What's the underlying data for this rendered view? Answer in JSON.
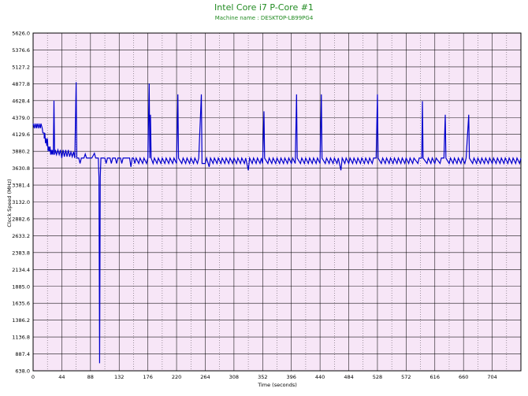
{
  "chart_data": {
    "type": "line",
    "title": "Intel Core i7 P-Core #1",
    "subtitle": "Machine name : DESKTOP-LB99PG4",
    "xlabel": "Time (seconds)",
    "ylabel": "Clock Speed (MHz)",
    "xlim": [
      0,
      748
    ],
    "ylim": [
      638.0,
      5626.0
    ],
    "x_ticks": [
      "0",
      "44",
      "88",
      "132",
      "176",
      "220",
      "264",
      "308",
      "352",
      "396",
      "440",
      "484",
      "528",
      "572",
      "616",
      "660",
      "704"
    ],
    "y_ticks": [
      "638.0",
      "887.4",
      "1136.8",
      "1386.2",
      "1635.6",
      "1885.0",
      "2134.4",
      "2383.8",
      "2633.2",
      "2882.6",
      "3132.0",
      "3381.4",
      "3630.8",
      "3880.2",
      "4129.6",
      "4379.0",
      "4628.4",
      "4877.8",
      "5127.2",
      "5376.6",
      "5626.0"
    ],
    "grid": true,
    "legend": "none",
    "series": [
      {
        "values": [
          [
            0,
            4290
          ],
          [
            2,
            4220
          ],
          [
            3,
            4290
          ],
          [
            5,
            4220
          ],
          [
            6,
            4290
          ],
          [
            8,
            4220
          ],
          [
            9,
            4290
          ],
          [
            11,
            4220
          ],
          [
            12,
            4290
          ],
          [
            14,
            4220
          ],
          [
            15,
            4150
          ],
          [
            17,
            4150
          ],
          [
            17,
            4070
          ],
          [
            18,
            4150
          ],
          [
            19,
            4000
          ],
          [
            20,
            4070
          ],
          [
            21,
            3960
          ],
          [
            22,
            4070
          ],
          [
            23,
            3880
          ],
          [
            24,
            3950
          ],
          [
            25,
            3880
          ],
          [
            26,
            3950
          ],
          [
            27,
            3830
          ],
          [
            28,
            3900
          ],
          [
            29,
            3830
          ],
          [
            30,
            3900
          ],
          [
            31,
            3830
          ],
          [
            32,
            4630
          ],
          [
            33,
            3830
          ],
          [
            34,
            3900
          ],
          [
            36,
            3830
          ],
          [
            38,
            3900
          ],
          [
            40,
            3830
          ],
          [
            42,
            3900
          ],
          [
            44,
            3780
          ],
          [
            46,
            3900
          ],
          [
            48,
            3800
          ],
          [
            50,
            3900
          ],
          [
            52,
            3800
          ],
          [
            54,
            3900
          ],
          [
            56,
            3800
          ],
          [
            58,
            3870
          ],
          [
            60,
            3800
          ],
          [
            62,
            3870
          ],
          [
            64,
            3780
          ],
          [
            66,
            4900
          ],
          [
            67,
            3780
          ],
          [
            70,
            3780
          ],
          [
            72,
            3700
          ],
          [
            74,
            3780
          ],
          [
            78,
            3780
          ],
          [
            80,
            3840
          ],
          [
            82,
            3780
          ],
          [
            90,
            3780
          ],
          [
            94,
            3850
          ],
          [
            96,
            3780
          ],
          [
            100,
            3780
          ],
          [
            101,
            3500
          ],
          [
            102,
            750
          ],
          [
            103,
            3500
          ],
          [
            104,
            3780
          ],
          [
            110,
            3780
          ],
          [
            112,
            3700
          ],
          [
            114,
            3780
          ],
          [
            118,
            3780
          ],
          [
            120,
            3700
          ],
          [
            122,
            3780
          ],
          [
            126,
            3780
          ],
          [
            128,
            3700
          ],
          [
            130,
            3780
          ],
          [
            134,
            3780
          ],
          [
            136,
            3700
          ],
          [
            138,
            3780
          ],
          [
            148,
            3780
          ],
          [
            150,
            3650
          ],
          [
            152,
            3780
          ],
          [
            154,
            3780
          ],
          [
            156,
            3700
          ],
          [
            158,
            3780
          ],
          [
            162,
            3700
          ],
          [
            164,
            3780
          ],
          [
            168,
            3700
          ],
          [
            170,
            3780
          ],
          [
            174,
            3700
          ],
          [
            176,
            3780
          ],
          [
            178,
            4880
          ],
          [
            179,
            3780
          ],
          [
            180,
            4420
          ],
          [
            181,
            3780
          ],
          [
            184,
            3700
          ],
          [
            186,
            3780
          ],
          [
            190,
            3700
          ],
          [
            192,
            3780
          ],
          [
            196,
            3700
          ],
          [
            198,
            3780
          ],
          [
            202,
            3700
          ],
          [
            204,
            3780
          ],
          [
            208,
            3700
          ],
          [
            210,
            3780
          ],
          [
            214,
            3700
          ],
          [
            216,
            3780
          ],
          [
            220,
            3700
          ],
          [
            222,
            4720
          ],
          [
            223,
            3780
          ],
          [
            228,
            3700
          ],
          [
            230,
            3780
          ],
          [
            234,
            3700
          ],
          [
            236,
            3780
          ],
          [
            240,
            3700
          ],
          [
            242,
            3780
          ],
          [
            246,
            3700
          ],
          [
            248,
            3780
          ],
          [
            252,
            3700
          ],
          [
            254,
            3780
          ],
          [
            258,
            4720
          ],
          [
            259,
            3700
          ],
          [
            264,
            3700
          ],
          [
            266,
            3780
          ],
          [
            270,
            3650
          ],
          [
            272,
            3780
          ],
          [
            276,
            3700
          ],
          [
            278,
            3780
          ],
          [
            282,
            3700
          ],
          [
            284,
            3780
          ],
          [
            288,
            3700
          ],
          [
            290,
            3780
          ],
          [
            294,
            3700
          ],
          [
            296,
            3780
          ],
          [
            300,
            3700
          ],
          [
            302,
            3780
          ],
          [
            306,
            3700
          ],
          [
            308,
            3780
          ],
          [
            312,
            3700
          ],
          [
            314,
            3780
          ],
          [
            318,
            3700
          ],
          [
            320,
            3780
          ],
          [
            324,
            3700
          ],
          [
            326,
            3780
          ],
          [
            330,
            3600
          ],
          [
            332,
            3780
          ],
          [
            336,
            3700
          ],
          [
            338,
            3780
          ],
          [
            342,
            3700
          ],
          [
            344,
            3780
          ],
          [
            348,
            3700
          ],
          [
            350,
            3780
          ],
          [
            352,
            3700
          ],
          [
            354,
            4470
          ],
          [
            355,
            3780
          ],
          [
            360,
            3700
          ],
          [
            362,
            3780
          ],
          [
            366,
            3700
          ],
          [
            368,
            3780
          ],
          [
            372,
            3700
          ],
          [
            374,
            3780
          ],
          [
            378,
            3700
          ],
          [
            380,
            3780
          ],
          [
            384,
            3700
          ],
          [
            386,
            3780
          ],
          [
            390,
            3700
          ],
          [
            392,
            3780
          ],
          [
            396,
            3700
          ],
          [
            398,
            3780
          ],
          [
            402,
            3700
          ],
          [
            404,
            4720
          ],
          [
            405,
            3780
          ],
          [
            410,
            3700
          ],
          [
            412,
            3780
          ],
          [
            416,
            3700
          ],
          [
            418,
            3780
          ],
          [
            422,
            3700
          ],
          [
            424,
            3780
          ],
          [
            428,
            3700
          ],
          [
            430,
            3780
          ],
          [
            434,
            3700
          ],
          [
            436,
            3780
          ],
          [
            440,
            3700
          ],
          [
            442,
            4720
          ],
          [
            443,
            3780
          ],
          [
            448,
            3700
          ],
          [
            450,
            3780
          ],
          [
            454,
            3700
          ],
          [
            456,
            3780
          ],
          [
            460,
            3700
          ],
          [
            462,
            3780
          ],
          [
            466,
            3700
          ],
          [
            468,
            3780
          ],
          [
            472,
            3600
          ],
          [
            474,
            3780
          ],
          [
            478,
            3700
          ],
          [
            480,
            3780
          ],
          [
            484,
            3700
          ],
          [
            486,
            3780
          ],
          [
            490,
            3700
          ],
          [
            492,
            3780
          ],
          [
            496,
            3700
          ],
          [
            498,
            3780
          ],
          [
            502,
            3700
          ],
          [
            504,
            3780
          ],
          [
            508,
            3700
          ],
          [
            510,
            3780
          ],
          [
            514,
            3700
          ],
          [
            516,
            3780
          ],
          [
            520,
            3700
          ],
          [
            522,
            3780
          ],
          [
            526,
            3780
          ],
          [
            528,
            4720
          ],
          [
            529,
            3780
          ],
          [
            534,
            3700
          ],
          [
            536,
            3780
          ],
          [
            540,
            3700
          ],
          [
            542,
            3780
          ],
          [
            546,
            3700
          ],
          [
            548,
            3780
          ],
          [
            552,
            3700
          ],
          [
            554,
            3780
          ],
          [
            558,
            3700
          ],
          [
            560,
            3780
          ],
          [
            564,
            3700
          ],
          [
            566,
            3780
          ],
          [
            570,
            3700
          ],
          [
            572,
            3780
          ],
          [
            576,
            3700
          ],
          [
            578,
            3780
          ],
          [
            582,
            3700
          ],
          [
            584,
            3780
          ],
          [
            590,
            3700
          ],
          [
            592,
            3780
          ],
          [
            596,
            3780
          ],
          [
            597,
            4620
          ],
          [
            598,
            3780
          ],
          [
            604,
            3700
          ],
          [
            606,
            3780
          ],
          [
            610,
            3700
          ],
          [
            612,
            3780
          ],
          [
            616,
            3700
          ],
          [
            618,
            3780
          ],
          [
            624,
            3700
          ],
          [
            626,
            3780
          ],
          [
            630,
            3780
          ],
          [
            632,
            4420
          ],
          [
            633,
            3780
          ],
          [
            638,
            3700
          ],
          [
            640,
            3780
          ],
          [
            644,
            3700
          ],
          [
            646,
            3780
          ],
          [
            650,
            3700
          ],
          [
            652,
            3780
          ],
          [
            656,
            3700
          ],
          [
            658,
            3780
          ],
          [
            662,
            3700
          ],
          [
            664,
            3780
          ],
          [
            668,
            4420
          ],
          [
            669,
            3780
          ],
          [
            674,
            3700
          ],
          [
            676,
            3780
          ],
          [
            680,
            3700
          ],
          [
            682,
            3780
          ],
          [
            686,
            3700
          ],
          [
            688,
            3780
          ],
          [
            692,
            3700
          ],
          [
            694,
            3780
          ],
          [
            698,
            3700
          ],
          [
            700,
            3780
          ],
          [
            704,
            3700
          ],
          [
            706,
            3780
          ],
          [
            710,
            3700
          ],
          [
            712,
            3780
          ],
          [
            716,
            3700
          ],
          [
            718,
            3780
          ],
          [
            722,
            3700
          ],
          [
            724,
            3780
          ],
          [
            728,
            3700
          ],
          [
            730,
            3780
          ],
          [
            734,
            3700
          ],
          [
            736,
            3780
          ],
          [
            740,
            3700
          ],
          [
            742,
            3780
          ],
          [
            746,
            3700
          ],
          [
            748,
            3780
          ]
        ]
      }
    ]
  },
  "colors": {
    "plot_background": "#f7e6f7",
    "grid": "#000000",
    "line": "#0000cd",
    "title": "#228b22"
  }
}
